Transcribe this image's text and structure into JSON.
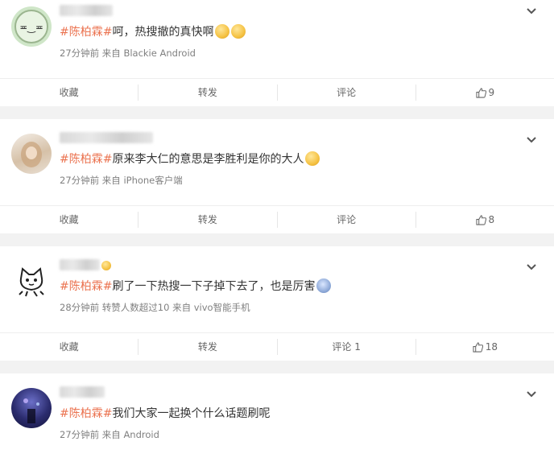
{
  "posts": [
    {
      "topic": "#陈柏霖#",
      "text": "呵，热搜撤的真快啊",
      "meta": "27分钟前 来自 Blackie⁠ Android",
      "actions": {
        "favorite": "收藏",
        "repost": "转发",
        "comment": "评论",
        "like": "9"
      },
      "emoji_count": 2
    },
    {
      "topic": "#陈柏霖#",
      "text": "原来李大仁的意思是李胜利是你的大人",
      "meta": "27分钟前 来自 iPhone客户端",
      "actions": {
        "favorite": "收藏",
        "repost": "转发",
        "comment": "评论",
        "like": "8"
      },
      "emoji_count": 1
    },
    {
      "topic": "#陈柏霖#",
      "text": "刷了一下热搜一下子掉下去了，也是厉害",
      "meta": "28分钟前 转赞人数超过10 来自 vivo智能手机",
      "actions": {
        "favorite": "收藏",
        "repost": "转发",
        "comment": "评论 1",
        "like": "18"
      },
      "emoji_count": 1
    },
    {
      "topic": "#陈柏霖#",
      "text": "我们大家一起换个什么话题刷呢",
      "meta": "27分钟前 来自 Android",
      "emoji_count": 0
    }
  ],
  "colors": {
    "topic": "#eb7350",
    "meta": "#808080",
    "background": "#f2f2f2"
  }
}
